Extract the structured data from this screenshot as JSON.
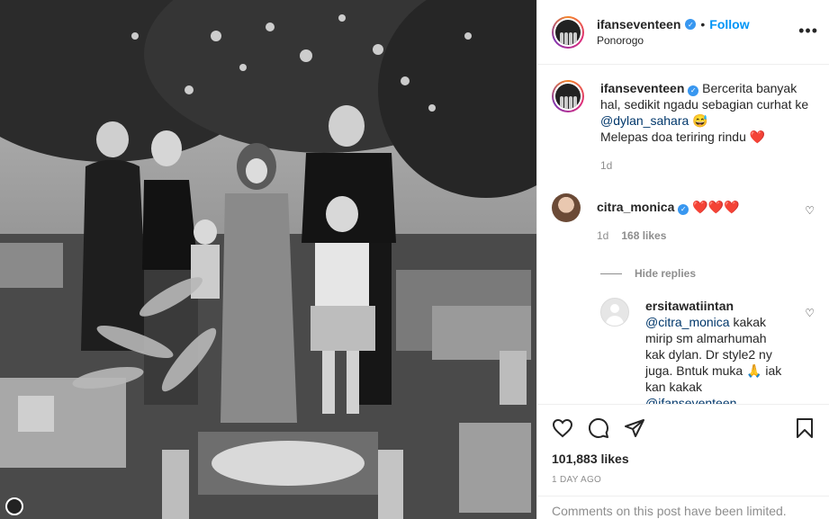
{
  "post": {
    "username": "ifanseventeen",
    "follow_label": "Follow",
    "location": "Ponorogo",
    "separator": "•",
    "more_label": "•••"
  },
  "caption": {
    "username": "ifanseventeen",
    "text_part1": "Bercerita banyak hal, sedikit ngadu sebagian curhat ke",
    "mention": "@dylan_sahara",
    "emoji1": "😅",
    "text_part2": "Melepas doa teriring rindu",
    "emoji2": "❤️",
    "time": "1d"
  },
  "comments": [
    {
      "username": "citra_monica",
      "text": "❤️❤️❤️",
      "time": "1d",
      "likes": "168 likes",
      "hide_replies": "Hide replies"
    }
  ],
  "replies": [
    {
      "username": "ersitawatiintan",
      "mention": "@citra_monica",
      "text": " kakak mirip sm almarhumah kak dylan. Dr style2 ny juga. Bntuk muka 🙏 iak kan kakak",
      "mention2": "@ifanseventeen"
    }
  ],
  "footer": {
    "likes": "101,883 likes",
    "time_ago": "1 DAY AGO",
    "limited_notice": "Comments on this post have been limited."
  },
  "icons": {
    "verified": "verified-badge-icon",
    "like": "heart-icon",
    "comment": "comment-icon",
    "share": "share-icon",
    "save": "bookmark-icon"
  },
  "colors": {
    "link_blue": "#0095f6",
    "mention_blue": "#00376b",
    "muted_grey": "#8e8e8e",
    "heart_red": "#ed4956"
  }
}
